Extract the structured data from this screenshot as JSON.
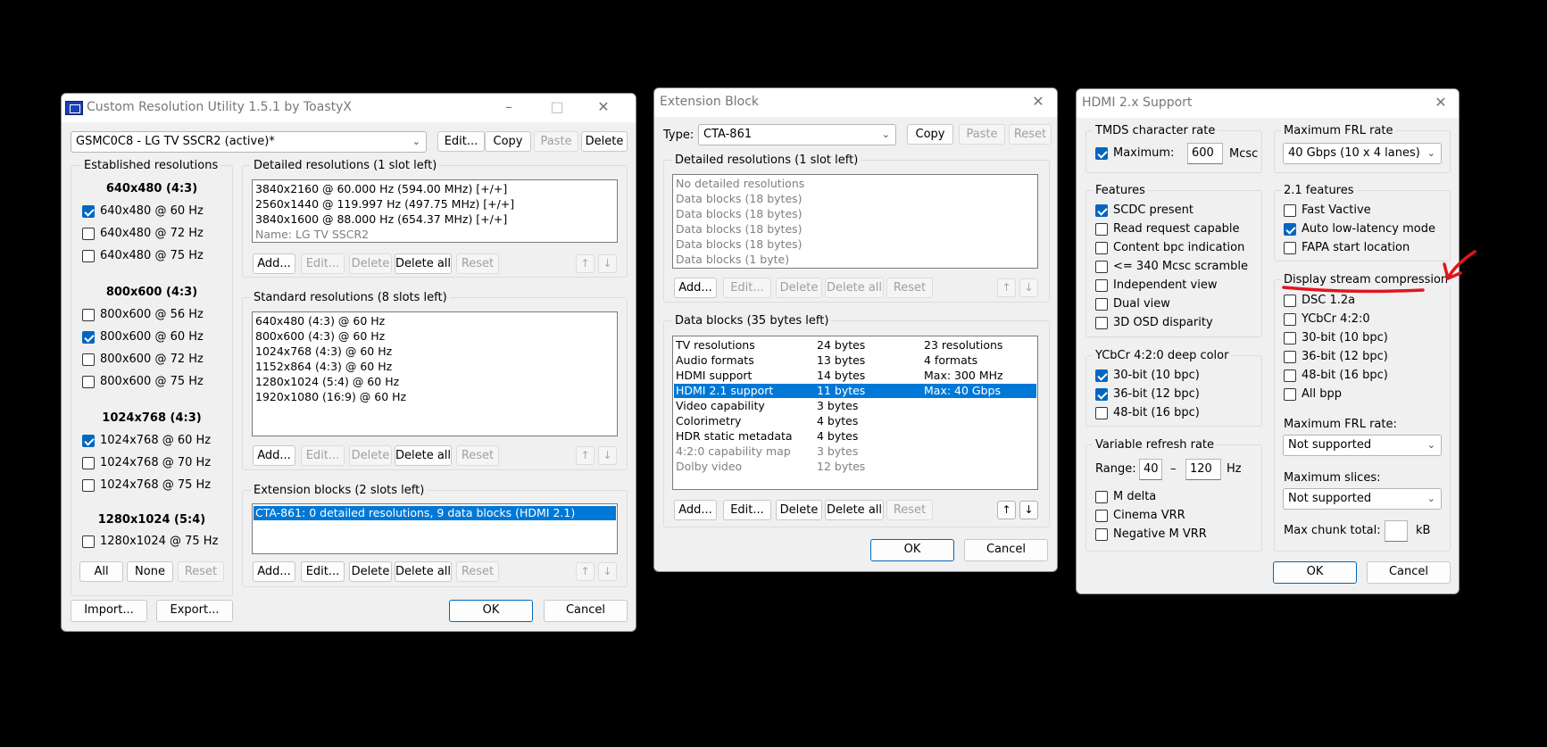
{
  "cru": {
    "title": "Custom Resolution Utility 1.5.1 by ToastyX",
    "monitor": "GSMC0C8 - LG TV SSCR2 (active)*",
    "top_buttons": [
      "Edit...",
      "Copy",
      "Paste",
      "Delete"
    ],
    "established": {
      "title": "Established resolutions",
      "groups": [
        {
          "header": "640x480 (4:3)",
          "items": [
            {
              "label": "640x480 @ 60 Hz"
            },
            {
              "label": "640x480 @ 72 Hz"
            },
            {
              "label": "640x480 @ 75 Hz"
            }
          ]
        },
        {
          "header": "800x600 (4:3)",
          "items": [
            {
              "label": "800x600 @ 56 Hz"
            },
            {
              "label": "800x600 @ 60 Hz"
            },
            {
              "label": "800x600 @ 72 Hz"
            },
            {
              "label": "800x600 @ 75 Hz"
            }
          ]
        },
        {
          "header": "1024x768 (4:3)",
          "items": [
            {
              "label": "1024x768 @ 60 Hz"
            },
            {
              "label": "1024x768 @ 70 Hz"
            },
            {
              "label": "1024x768 @ 75 Hz"
            }
          ]
        },
        {
          "header": "1280x1024 (5:4)",
          "items": [
            {
              "label": "1280x1024 @ 75 Hz"
            }
          ]
        }
      ],
      "buttons": [
        "All",
        "None",
        "Reset"
      ]
    },
    "detailed": {
      "title": "Detailed resolutions (1 slot left)",
      "rows": [
        "3840x2160 @ 60.000 Hz (594.00 MHz) [+/+]",
        "2560x1440 @ 119.997 Hz (497.75 MHz) [+/+]",
        "3840x1600 @ 88.000 Hz (654.37 MHz) [+/+]"
      ],
      "name_row": "Name: LG TV SSCR2"
    },
    "standard": {
      "title": "Standard resolutions (8 slots left)",
      "rows": [
        "640x480 (4:3) @ 60 Hz",
        "800x600 (4:3) @ 60 Hz",
        "1024x768 (4:3) @ 60 Hz",
        "1152x864 (4:3) @ 60 Hz",
        "1280x1024 (5:4) @ 60 Hz",
        "1920x1080 (16:9) @ 60 Hz"
      ]
    },
    "extension": {
      "title": "Extension blocks (2 slots left)",
      "rows": [
        "CTA-861: 0 detailed resolutions, 9 data blocks (HDMI 2.1)"
      ]
    },
    "list_buttons": [
      "Add...",
      "Edit...",
      "Delete",
      "Delete all",
      "Reset"
    ],
    "arrows": [
      "↑",
      "↓"
    ],
    "import": "Import...",
    "export": "Export...",
    "ok": "OK",
    "cancel": "Cancel"
  },
  "ext": {
    "title": "Extension Block",
    "type_label": "Type:",
    "type_value": "CTA-861",
    "top_buttons": [
      "Copy",
      "Paste",
      "Reset"
    ],
    "detailed": {
      "title": "Detailed resolutions (1 slot left)",
      "rows": [
        "No detailed resolutions",
        "Data blocks (18 bytes)",
        "Data blocks (18 bytes)",
        "Data blocks (18 bytes)",
        "Data blocks (18 bytes)",
        "Data blocks (1 byte)"
      ]
    },
    "datablocks": {
      "title": "Data blocks (35 bytes left)",
      "rows": [
        {
          "name": "TV resolutions",
          "size": "24 bytes",
          "info": "23 resolutions"
        },
        {
          "name": "Audio formats",
          "size": "13 bytes",
          "info": "4 formats"
        },
        {
          "name": "HDMI support",
          "size": "14 bytes",
          "info": "Max: 300 MHz"
        },
        {
          "name": "HDMI 2.1 support",
          "size": "11 bytes",
          "info": "Max: 40 Gbps"
        },
        {
          "name": "Video capability",
          "size": "3 bytes",
          "info": ""
        },
        {
          "name": "Colorimetry",
          "size": "4 bytes",
          "info": ""
        },
        {
          "name": "HDR static metadata",
          "size": "4 bytes",
          "info": ""
        },
        {
          "name": "4:2:0 capability map",
          "size": "3 bytes",
          "info": ""
        },
        {
          "name": "Dolby video",
          "size": "12 bytes",
          "info": ""
        }
      ]
    },
    "list_buttons": [
      "Add...",
      "Edit...",
      "Delete",
      "Delete all",
      "Reset"
    ],
    "arrows": [
      "↑",
      "↓"
    ],
    "ok": "OK",
    "cancel": "Cancel"
  },
  "hdmi": {
    "title": "HDMI 2.x Support",
    "tmds": {
      "title": "TMDS character rate",
      "max_label": "Maximum:",
      "max_value": "600",
      "unit": "Mcsc"
    },
    "features": {
      "title": "Features",
      "items": [
        "SCDC present",
        "Read request capable",
        "Content bpc indication",
        "<= 340 Mcsc scramble",
        "Independent view",
        "Dual view",
        "3D OSD disparity"
      ]
    },
    "ycbcr": {
      "title": "YCbCr 4:2:0 deep color",
      "items": [
        "30-bit (10 bpc)",
        "36-bit (12 bpc)",
        "48-bit (16 bpc)"
      ]
    },
    "vrr": {
      "title": "Variable refresh rate",
      "range_label": "Range:",
      "min": "40",
      "dash": "–",
      "max": "120",
      "unit": "Hz",
      "items": [
        "M delta",
        "Cinema VRR",
        "Negative M VRR"
      ]
    },
    "frl": {
      "title": "Maximum FRL rate",
      "value": "40 Gbps (10 x 4 lanes)"
    },
    "f21": {
      "title": "2.1 features",
      "items": [
        "Fast Vactive",
        "Auto low-latency mode",
        "FAPA start location"
      ]
    },
    "dsc": {
      "title": "Display stream compression",
      "items": [
        "DSC 1.2a",
        "YCbCr 4:2:0",
        "30-bit (10 bpc)",
        "36-bit (12 bpc)",
        "48-bit (16 bpc)",
        "All bpp"
      ],
      "frl_label": "Maximum FRL rate:",
      "frl_value": "Not supported",
      "slices_label": "Maximum slices:",
      "slices_value": "Not supported",
      "chunk_label": "Max chunk total:",
      "chunk_value": "",
      "chunk_unit": "kB"
    },
    "ok": "OK",
    "cancel": "Cancel"
  },
  "annotation_color": "#e0141e"
}
